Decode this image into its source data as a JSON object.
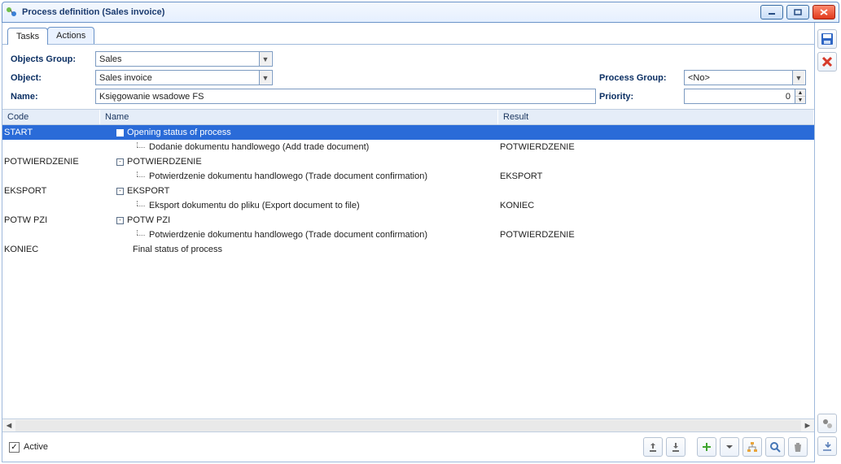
{
  "window": {
    "title": "Process definition (Sales invoice)"
  },
  "tabs": {
    "tasks": "Tasks",
    "actions": "Actions",
    "active": "tasks"
  },
  "form": {
    "objectsGroup": {
      "label": "Objects Group:",
      "value": "Sales"
    },
    "object": {
      "label": "Object:",
      "value": "Sales invoice"
    },
    "name": {
      "label": "Name:",
      "value": "Księgowanie wsadowe FS"
    },
    "processGroup": {
      "label": "Process Group:",
      "value": "<No>"
    },
    "priority": {
      "label": "Priority:",
      "value": "0"
    }
  },
  "columns": {
    "code": "Code",
    "name": "Name",
    "result": "Result"
  },
  "rows": [
    {
      "code": "START",
      "expand": "-",
      "name": "Opening status of process",
      "result": "",
      "selected": true,
      "kind": "group"
    },
    {
      "code": "",
      "name": "Dodanie dokumentu handlowego (Add trade document)",
      "result": "POTWIERDZENIE",
      "kind": "child"
    },
    {
      "code": "POTWIERDZENIE",
      "expand": "-",
      "name": "POTWIERDZENIE",
      "result": "",
      "kind": "group"
    },
    {
      "code": "",
      "name": "Potwierdzenie dokumentu handlowego (Trade document confirmation)",
      "result": "EKSPORT",
      "kind": "child"
    },
    {
      "code": "EKSPORT",
      "expand": "-",
      "name": "EKSPORT",
      "result": "",
      "kind": "group"
    },
    {
      "code": "",
      "name": "Eksport dokumentu do pliku (Export document to file)",
      "result": "KONIEC",
      "kind": "child"
    },
    {
      "code": "POTW PZI",
      "expand": "-",
      "name": "POTW PZI",
      "result": "",
      "kind": "group"
    },
    {
      "code": "",
      "name": "Potwierdzenie dokumentu handlowego (Trade document confirmation)",
      "result": "POTWIERDZENIE",
      "kind": "child"
    },
    {
      "code": "KONIEC",
      "name": "Final status of process",
      "result": "",
      "kind": "leaf"
    }
  ],
  "active": {
    "label": "Active",
    "checked": true
  }
}
